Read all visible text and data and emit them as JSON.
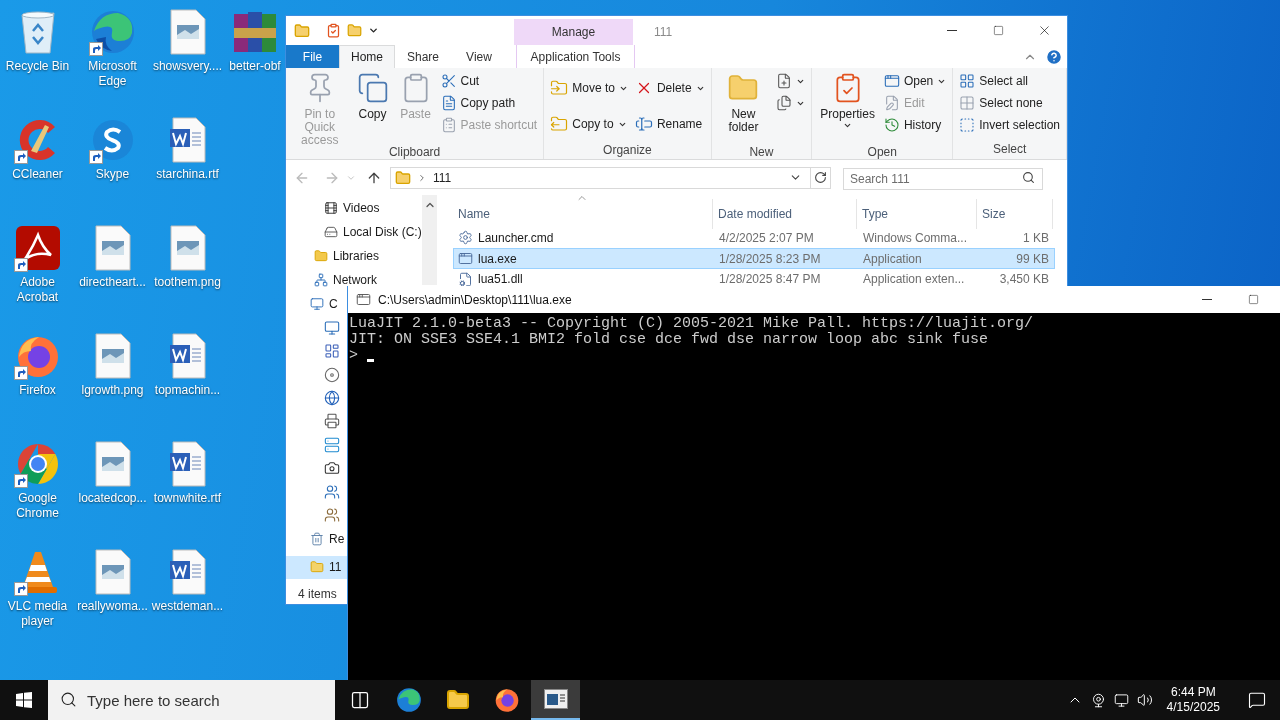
{
  "desktop_icons": [
    {
      "label": "Recycle Bin",
      "kind": "recycle",
      "shortcut": false
    },
    {
      "label": "CCleaner",
      "kind": "ccleaner",
      "shortcut": true
    },
    {
      "label": "Adobe Acrobat",
      "kind": "acrobat",
      "shortcut": true
    },
    {
      "label": "Firefox",
      "kind": "firefox",
      "shortcut": true
    },
    {
      "label": "Google Chrome",
      "kind": "chrome",
      "shortcut": true
    },
    {
      "label": "VLC media player",
      "kind": "vlc",
      "shortcut": true
    },
    {
      "label": "Microsoft Edge",
      "kind": "edge",
      "shortcut": true
    },
    {
      "label": "Skype",
      "kind": "skype",
      "shortcut": true
    },
    {
      "label": "directheart...",
      "kind": "image",
      "shortcut": false
    },
    {
      "label": "lgrowth.png",
      "kind": "image",
      "shortcut": false
    },
    {
      "label": "locatedcop...",
      "kind": "image",
      "shortcut": false
    },
    {
      "label": "reallywoma...",
      "kind": "image",
      "shortcut": false
    },
    {
      "label": "showsvery....",
      "kind": "image",
      "shortcut": false
    },
    {
      "label": "starchina.rtf",
      "kind": "word",
      "shortcut": false
    },
    {
      "label": "toothem.png",
      "kind": "image",
      "shortcut": false
    },
    {
      "label": "topmachin...",
      "kind": "word",
      "shortcut": false
    },
    {
      "label": "townwhite.rtf",
      "kind": "word",
      "shortcut": false
    },
    {
      "label": "westdeman...",
      "kind": "word",
      "shortcut": false
    },
    {
      "label": "better-obf",
      "kind": "archive",
      "shortcut": false
    }
  ],
  "explorer": {
    "title": "111",
    "context_label": "Manage",
    "tabs": [
      {
        "label": "File",
        "kind": "file",
        "selected": false
      },
      {
        "label": "Home",
        "kind": "tab",
        "selected": true
      },
      {
        "label": "Share",
        "kind": "tab",
        "selected": false
      },
      {
        "label": "View",
        "kind": "tab",
        "selected": false
      },
      {
        "label": "Application Tools",
        "kind": "context",
        "selected": false
      }
    ],
    "ribbon_groups": [
      {
        "title": "Clipboard",
        "columns": [
          [
            {
              "label": "Pin to Quick access",
              "kind": "pin",
              "disabled": true,
              "menu": false
            }
          ],
          [
            {
              "label": "Copy",
              "kind": "copy",
              "disabled": false,
              "menu": false
            }
          ],
          [
            {
              "label": "Paste",
              "kind": "paste",
              "disabled": true,
              "menu": false
            }
          ],
          [
            {
              "label": "Cut",
              "kind": "cut",
              "disabled": false,
              "menu": false
            },
            {
              "label": "Copy path",
              "kind": "copypath",
              "disabled": false,
              "menu": false
            },
            {
              "label": "Paste shortcut",
              "kind": "pasteshortcut",
              "disabled": true,
              "menu": false
            }
          ]
        ]
      },
      {
        "title": "Organize",
        "columns": [
          [
            {
              "label": "Move to",
              "kind": "moveto",
              "disabled": false,
              "menu": true
            },
            {
              "label": "Copy to",
              "kind": "copyto",
              "disabled": false,
              "menu": true
            }
          ],
          [
            {
              "label": "Delete",
              "kind": "delete",
              "disabled": false,
              "menu": true
            },
            {
              "label": "Rename",
              "kind": "rename",
              "disabled": false,
              "menu": false
            }
          ]
        ]
      },
      {
        "title": "New",
        "columns": [
          [
            {
              "label": "New folder",
              "kind": "newfolder",
              "disabled": false,
              "menu": false
            }
          ],
          [
            {
              "kind": "newitem",
              "disabled": false,
              "menu": true
            },
            {
              "kind": "easyaccess",
              "disabled": false,
              "menu": true
            }
          ]
        ]
      },
      {
        "title": "Open",
        "columns": [
          [
            {
              "label": "Properties",
              "kind": "properties",
              "disabled": false,
              "menu": true
            }
          ],
          [
            {
              "label": "Open",
              "kind": "open",
              "disabled": false,
              "menu": true
            },
            {
              "label": "Edit",
              "kind": "edit",
              "disabled": true,
              "menu": false
            },
            {
              "label": "History",
              "kind": "history",
              "disabled": false,
              "menu": false
            }
          ]
        ]
      },
      {
        "title": "Select",
        "columns": [
          [
            {
              "label": "Select all",
              "kind": "selectall",
              "disabled": false,
              "menu": false
            },
            {
              "label": "Select none",
              "kind": "selectnone",
              "disabled": false,
              "menu": false
            },
            {
              "label": "Invert selection",
              "kind": "invert",
              "disabled": false,
              "menu": false
            }
          ]
        ]
      }
    ],
    "address": {
      "path": "111",
      "search_placeholder": "Search 111"
    },
    "nav_items": [
      {
        "label": "Videos",
        "kind": "videos",
        "selected": false
      },
      {
        "label": "Local Disk (C:)",
        "kind": "drive",
        "selected": false
      },
      {
        "label": "Libraries",
        "kind": "library",
        "selected": false
      },
      {
        "label": "Network",
        "kind": "network",
        "selected": false
      },
      {
        "label": "C",
        "kind": "computer",
        "selected": false
      },
      {
        "label": "Re",
        "kind": "recycle",
        "selected": false
      },
      {
        "label": "11",
        "kind": "folder",
        "selected": true
      }
    ],
    "columns": [
      "Name",
      "Date modified",
      "Type",
      "Size"
    ],
    "files": [
      {
        "name": "Launcher.cmd",
        "kind": "script",
        "date": "4/2/2025 2:07 PM",
        "type": "Windows Comma...",
        "size": "1 KB",
        "selected": false
      },
      {
        "name": "lua.exe",
        "kind": "app",
        "date": "1/28/2025 8:23 PM",
        "type": "Application",
        "size": "99 KB",
        "selected": true
      },
      {
        "name": "lua51.dll",
        "kind": "library",
        "date": "1/28/2025 8:47 PM",
        "type": "Application exten...",
        "size": "3,450 KB",
        "selected": false
      }
    ],
    "status": "4 items"
  },
  "console": {
    "title": "C:\\Users\\admin\\Desktop\\111\\lua.exe",
    "lines": [
      "LuaJIT 2.1.0-beta3 -- Copyright (C) 2005-2021 Mike Pall. https://luajit.org/",
      "JIT: ON SSE3 SSE4.1 BMI2 fold cse dce fwd dse narrow loop abc sink fuse"
    ],
    "prompt": ">"
  },
  "taskbar": {
    "search_placeholder": "Type here to search",
    "apps": [
      {
        "kind": "taskview",
        "selected": false
      },
      {
        "kind": "edge",
        "selected": false
      },
      {
        "kind": "explorer",
        "selected": false
      },
      {
        "kind": "firefox",
        "selected": false
      },
      {
        "kind": "console",
        "selected": true
      }
    ],
    "time": "6:44 PM",
    "date": "4/15/2025"
  }
}
